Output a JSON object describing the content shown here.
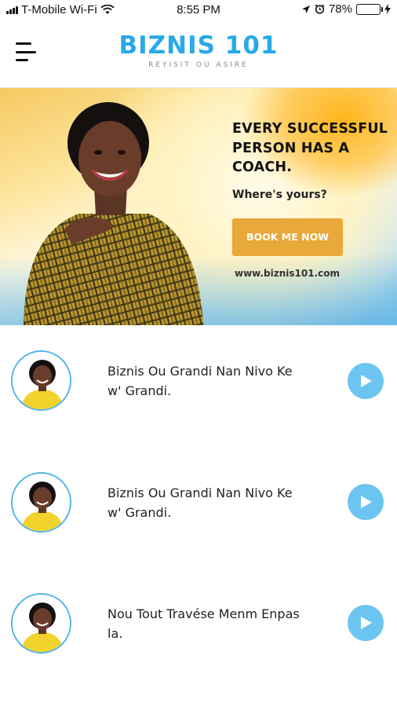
{
  "status_bar": {
    "carrier": "T-Mobile Wi-Fi",
    "time": "8:55 PM",
    "battery": "78%",
    "battery_level": 0.78
  },
  "header": {
    "logo_title": "BIZNIS 101",
    "logo_subtitle": "REYISIT OU ASIRE",
    "menu_icon": "hamburger-menu-icon"
  },
  "banner": {
    "headline": "EVERY SUCCESSFUL PERSON HAS A COACH.",
    "tagline": "Where's yours?",
    "button_label": "BOOK ME NOW",
    "url": "www.biznis101.com"
  },
  "episodes": [
    {
      "title": "Biznis Ou Grandi Nan Nivo Ke w' Grandi."
    },
    {
      "title": "Biznis Ou Grandi Nan Nivo Ke w' Grandi."
    },
    {
      "title": "Nou Tout Travése Menm Enpas la."
    }
  ],
  "colors": {
    "brand_blue": "#29a9e8",
    "play_button": "#6cc4f1",
    "cta_button": "#e8a83a"
  }
}
